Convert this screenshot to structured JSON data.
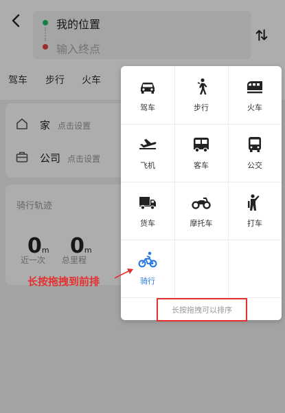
{
  "header": {
    "my_location": "我的位置",
    "destination_placeholder": "输入终点"
  },
  "tabs": [
    "驾车",
    "步行",
    "火车"
  ],
  "shortcuts": {
    "home": {
      "label": "家",
      "hint": "点击设置"
    },
    "work": {
      "label": "公司",
      "hint": "点击设置"
    }
  },
  "track": {
    "title": "骑行轨迹",
    "last": {
      "value": "0",
      "unit": "m",
      "caption": "近一次"
    },
    "total": {
      "value": "0",
      "unit": "m",
      "caption": "总里程"
    }
  },
  "modes": [
    {
      "label": "驾车",
      "icon": "car-icon"
    },
    {
      "label": "步行",
      "icon": "walk-icon"
    },
    {
      "label": "火车",
      "icon": "train-icon"
    },
    {
      "label": "飞机",
      "icon": "plane-icon"
    },
    {
      "label": "客车",
      "icon": "coach-icon"
    },
    {
      "label": "公交",
      "icon": "bus-icon"
    },
    {
      "label": "货车",
      "icon": "truck-icon"
    },
    {
      "label": "摩托车",
      "icon": "motorcycle-icon"
    },
    {
      "label": "打车",
      "icon": "taxi-hail-icon"
    },
    {
      "label": "骑行",
      "icon": "bicycle-icon"
    }
  ],
  "sort_hint": "长按拖拽可以排序",
  "annotation": "长按拖拽到前排",
  "colors": {
    "accent": "#2a7be4",
    "annotation": "#e3302f"
  }
}
